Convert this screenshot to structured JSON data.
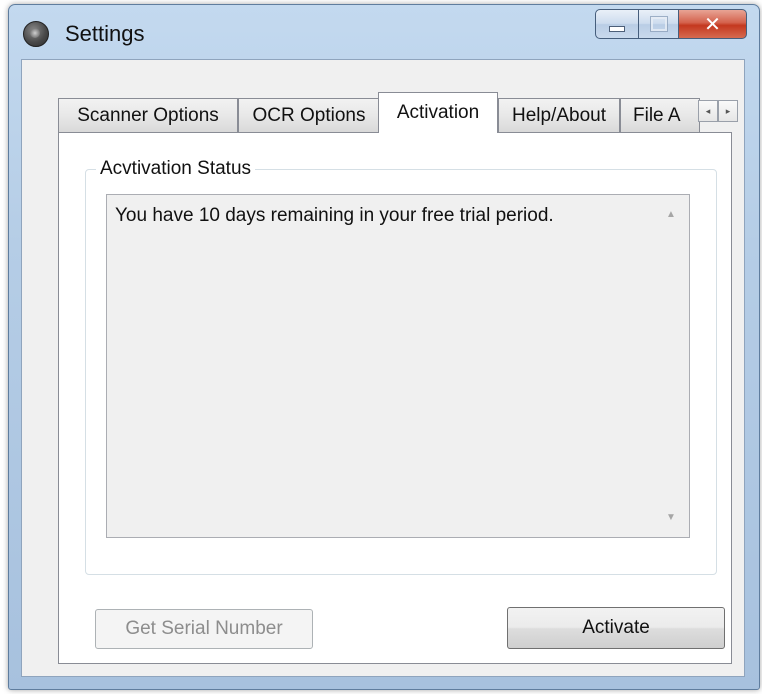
{
  "window": {
    "title": "Settings",
    "min_glyph": "—",
    "close_glyph": "✕"
  },
  "tabs": [
    {
      "label": "Scanner Options",
      "active": false
    },
    {
      "label": "OCR Options",
      "active": false
    },
    {
      "label": "Activation",
      "active": true
    },
    {
      "label": "Help/About",
      "active": false
    },
    {
      "label": "File A",
      "active": false
    }
  ],
  "tab_scroll": {
    "left": "◂",
    "right": "▸"
  },
  "activation": {
    "group_label": "Acvtivation Status",
    "status_text": "You have 10 days remaining in your free trial period.",
    "scroll_up": "▲",
    "scroll_down": "▼"
  },
  "buttons": {
    "serial_label": "Get Serial Number",
    "serial_enabled": false,
    "activate_label": "Activate"
  },
  "icons": {
    "app": "scanner-app-icon",
    "minimize": "minimize-icon",
    "maximize": "maximize-icon",
    "close": "close-icon"
  },
  "colors": {
    "titlebar": "#b5cde6",
    "close_button": "#c4381f",
    "panel": "#ffffff",
    "client": "#f0f0f0"
  }
}
